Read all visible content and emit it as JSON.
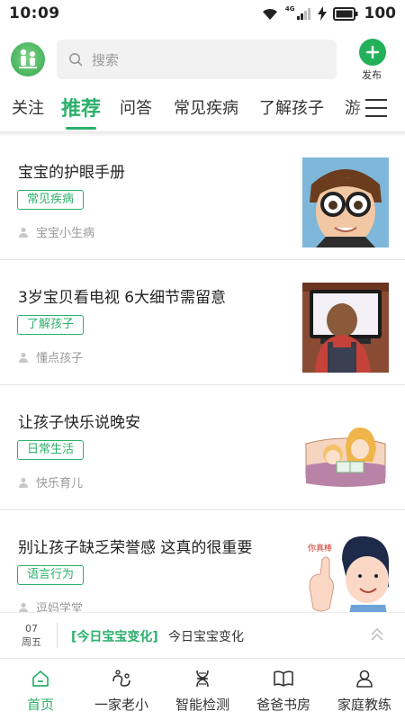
{
  "status_bar": {
    "time": "10:09",
    "battery": "100",
    "network": "4G"
  },
  "header": {
    "search_placeholder": "搜索",
    "publish_label": "发布"
  },
  "tabs": [
    {
      "label": "关注",
      "active": false
    },
    {
      "label": "推荐",
      "active": true
    },
    {
      "label": "问答",
      "active": false
    },
    {
      "label": "常见疾病",
      "active": false
    },
    {
      "label": "了解孩子",
      "active": false
    },
    {
      "label": "游",
      "active": false
    }
  ],
  "articles": [
    {
      "title": "宝宝的护眼手册",
      "tag": "常见疾病",
      "author": "宝宝小生病"
    },
    {
      "title": "3岁宝贝看电视 6大细节需留意",
      "tag": "了解孩子",
      "author": "懂点孩子"
    },
    {
      "title": "让孩子快乐说晚安",
      "tag": "日常生活",
      "author": "快乐育儿"
    },
    {
      "title": "别让孩子缺乏荣誉感 这真的很重要",
      "tag": "语言行为",
      "author": "逗妈学堂",
      "image_caption": "你真棒"
    }
  ],
  "ticker": {
    "day": "07",
    "weekday": "周五",
    "tag": "[今日宝宝变化]",
    "text": "今日宝宝变化"
  },
  "bottom_nav": [
    {
      "label": "首页",
      "icon": "home-icon",
      "active": true
    },
    {
      "label": "一家老小",
      "icon": "family-icon",
      "active": false
    },
    {
      "label": "智能检测",
      "icon": "dna-icon",
      "active": false
    },
    {
      "label": "爸爸书房",
      "icon": "book-icon",
      "active": false
    },
    {
      "label": "家庭教练",
      "icon": "coach-icon",
      "active": false
    }
  ],
  "colors": {
    "accent": "#2bb06a",
    "publish": "#22b05a"
  }
}
